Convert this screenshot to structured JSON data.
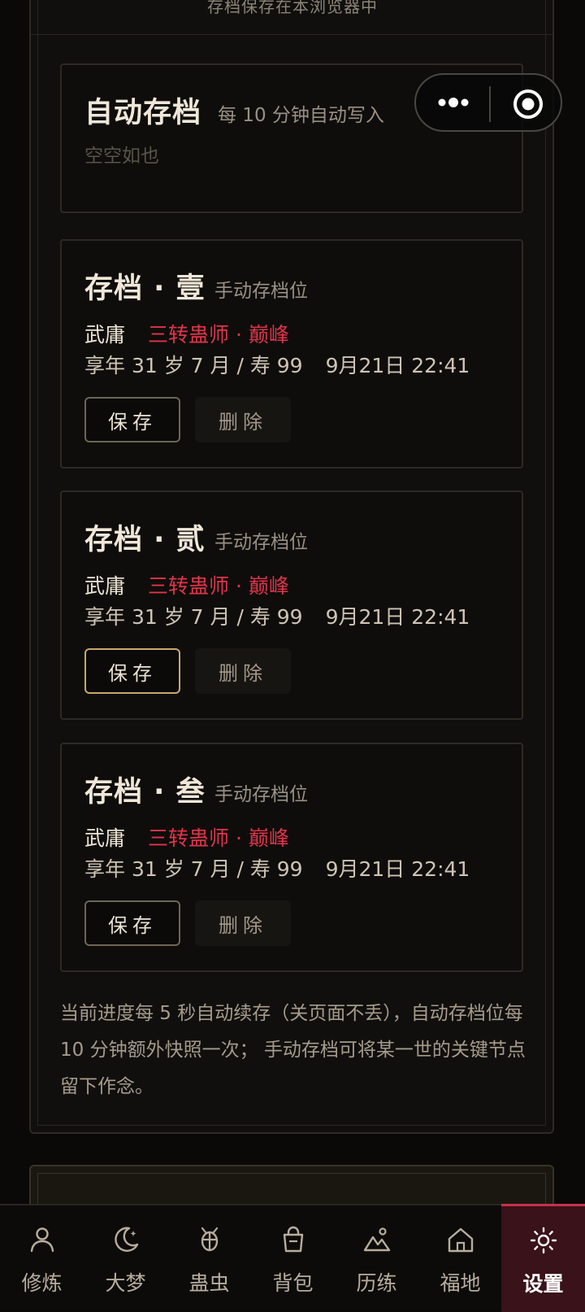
{
  "top_note": "存档保存在本浏览器中",
  "auto_slot": {
    "title": "自动存档",
    "subtitle": "每 10 分钟自动写入",
    "empty_text": "空空如也"
  },
  "manual_slots": [
    {
      "title": "存档 · 壹",
      "subtitle": "手动存档位",
      "name": "武庸",
      "rank": "三转蛊师 · 巅峰",
      "age_life": "享年 31 岁 7 月 / 寿 99",
      "time": "9月21日 22:41",
      "save_label": "保存",
      "delete_label": "删除"
    },
    {
      "title": "存档 · 贰",
      "subtitle": "手动存档位",
      "name": "武庸",
      "rank": "三转蛊师 · 巅峰",
      "age_life": "享年 31 岁 7 月 / 寿 99",
      "time": "9月21日 22:41",
      "save_label": "保存",
      "delete_label": "删除"
    },
    {
      "title": "存档 · 叁",
      "subtitle": "手动存档位",
      "name": "武庸",
      "rank": "三转蛊师 · 巅峰",
      "age_life": "享年 31 岁 7 月 / 寿 99",
      "time": "9月21日 22:41",
      "save_label": "保存",
      "delete_label": "删除"
    }
  ],
  "note": "当前进度每 5 秒自动续存（关页面不丢），自动存档位每 10 分钟额外快照一次； 手动存档可将某一世的关键节点留下作念。",
  "capsule": {
    "more_icon": "more-dots-icon",
    "close_icon": "target-close-icon"
  },
  "tabs": [
    {
      "label": "修炼",
      "icon": "person-icon"
    },
    {
      "label": "大梦",
      "icon": "moon-icon"
    },
    {
      "label": "蛊虫",
      "icon": "bug-icon"
    },
    {
      "label": "背包",
      "icon": "bag-icon"
    },
    {
      "label": "历练",
      "icon": "mountain-icon"
    },
    {
      "label": "福地",
      "icon": "home-icon"
    },
    {
      "label": "设置",
      "icon": "sun-gear-icon",
      "active": true
    }
  ],
  "colors": {
    "accent_red": "#e0344a",
    "active_tab_bg": "#3a1219",
    "gold_border": "#c9a86a"
  }
}
